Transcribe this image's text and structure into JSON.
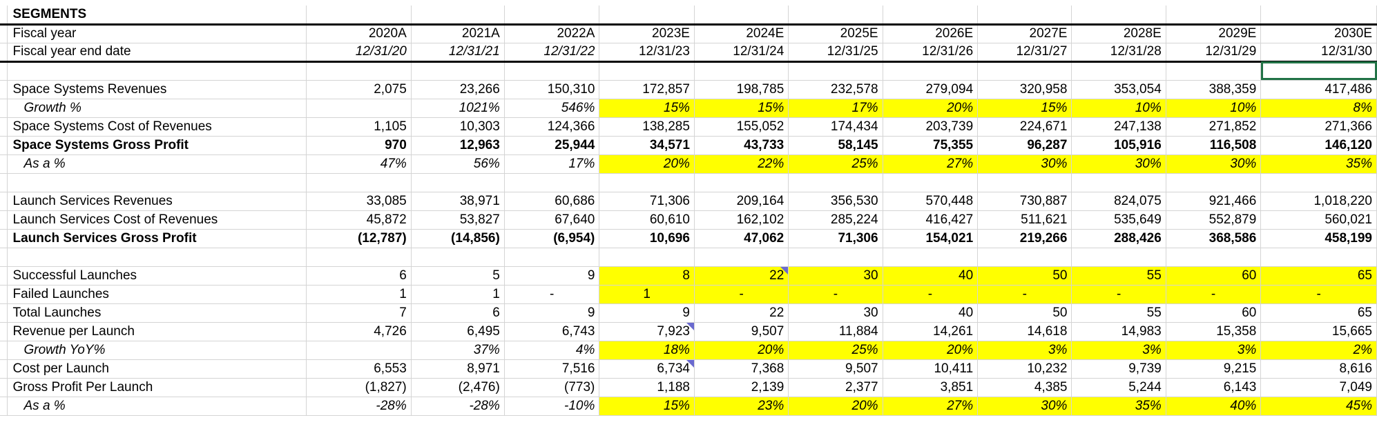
{
  "title": "SEGMENTS",
  "header": {
    "label_year": "Fiscal year",
    "label_date": "Fiscal year end date",
    "years": [
      "2020A",
      "2021A",
      "2022A",
      "2023E",
      "2024E",
      "2025E",
      "2026E",
      "2027E",
      "2028E",
      "2029E",
      "2030E"
    ],
    "dates": [
      "12/31/20",
      "12/31/21",
      "12/31/22",
      "12/31/23",
      "12/31/24",
      "12/31/25",
      "12/31/26",
      "12/31/27",
      "12/31/28",
      "12/31/29",
      "12/31/30"
    ]
  },
  "rows": {
    "ss_rev": {
      "label": "Space Systems Revenues",
      "values": [
        "2,075",
        "23,266",
        "150,310",
        "172,857",
        "198,785",
        "232,578",
        "279,094",
        "320,958",
        "353,054",
        "388,359",
        "417,486"
      ]
    },
    "ss_growth": {
      "label": "Growth %",
      "values": [
        "",
        "1021%",
        "546%",
        "15%",
        "15%",
        "17%",
        "20%",
        "15%",
        "10%",
        "10%",
        "8%"
      ]
    },
    "ss_cost": {
      "label": "Space Systems Cost of Revenues",
      "values": [
        "1,105",
        "10,303",
        "124,366",
        "138,285",
        "155,052",
        "174,434",
        "203,739",
        "224,671",
        "247,138",
        "271,852",
        "271,366"
      ]
    },
    "ss_gp": {
      "label": "Space Systems Gross Profit",
      "values": [
        "970",
        "12,963",
        "25,944",
        "34,571",
        "43,733",
        "58,145",
        "75,355",
        "96,287",
        "105,916",
        "116,508",
        "146,120"
      ]
    },
    "ss_pct": {
      "label": "As a %",
      "values": [
        "47%",
        "56%",
        "17%",
        "20%",
        "22%",
        "25%",
        "27%",
        "30%",
        "30%",
        "30%",
        "35%"
      ]
    },
    "ls_rev": {
      "label": "Launch Services Revenues",
      "values": [
        "33,085",
        "38,971",
        "60,686",
        "71,306",
        "209,164",
        "356,530",
        "570,448",
        "730,887",
        "824,075",
        "921,466",
        "1,018,220"
      ]
    },
    "ls_cost": {
      "label": "Launch Services Cost of Revenues",
      "values": [
        "45,872",
        "53,827",
        "67,640",
        "60,610",
        "162,102",
        "285,224",
        "416,427",
        "511,621",
        "535,649",
        "552,879",
        "560,021"
      ]
    },
    "ls_gp": {
      "label": "Launch Services Gross Profit",
      "values": [
        "(12,787)",
        "(14,856)",
        "(6,954)",
        "10,696",
        "47,062",
        "71,306",
        "154,021",
        "219,266",
        "288,426",
        "368,586",
        "458,199"
      ]
    },
    "succ": {
      "label": "Successful Launches",
      "values": [
        "6",
        "5",
        "9",
        "8",
        "22",
        "30",
        "40",
        "50",
        "55",
        "60",
        "65"
      ]
    },
    "fail": {
      "label": "Failed Launches",
      "values": [
        "1",
        "1",
        "-",
        "1",
        "-",
        "-",
        "-",
        "-",
        "-",
        "-",
        "-"
      ]
    },
    "total": {
      "label": "Total Launches",
      "values": [
        "7",
        "6",
        "9",
        "9",
        "22",
        "30",
        "40",
        "50",
        "55",
        "60",
        "65"
      ]
    },
    "rpl": {
      "label": "Revenue per Launch",
      "values": [
        "4,726",
        "6,495",
        "6,743",
        "7,923",
        "9,507",
        "11,884",
        "14,261",
        "14,618",
        "14,983",
        "15,358",
        "15,665"
      ]
    },
    "rpl_growth": {
      "label": "Growth YoY%",
      "values": [
        "",
        "37%",
        "4%",
        "18%",
        "20%",
        "25%",
        "20%",
        "3%",
        "3%",
        "3%",
        "2%"
      ]
    },
    "cpl": {
      "label": "Cost per Launch",
      "values": [
        "6,553",
        "8,971",
        "7,516",
        "6,734",
        "7,368",
        "9,507",
        "10,411",
        "10,232",
        "9,739",
        "9,215",
        "8,616"
      ]
    },
    "gppl": {
      "label": "Gross Profit Per Launch",
      "values": [
        "(1,827)",
        "(2,476)",
        "(773)",
        "1,188",
        "2,139",
        "2,377",
        "3,851",
        "4,385",
        "5,244",
        "6,143",
        "7,049"
      ]
    },
    "gppl_pct": {
      "label": "As a %",
      "values": [
        "-28%",
        "-28%",
        "-10%",
        "15%",
        "23%",
        "20%",
        "27%",
        "30%",
        "35%",
        "40%",
        "45%"
      ]
    }
  },
  "colors": {
    "input_blue": "#0000ff",
    "highlight_yellow": "#ffff00",
    "selection_green": "#217346",
    "comment_marker": "#6a6acf",
    "pct_gray": "#7f7f7f"
  }
}
